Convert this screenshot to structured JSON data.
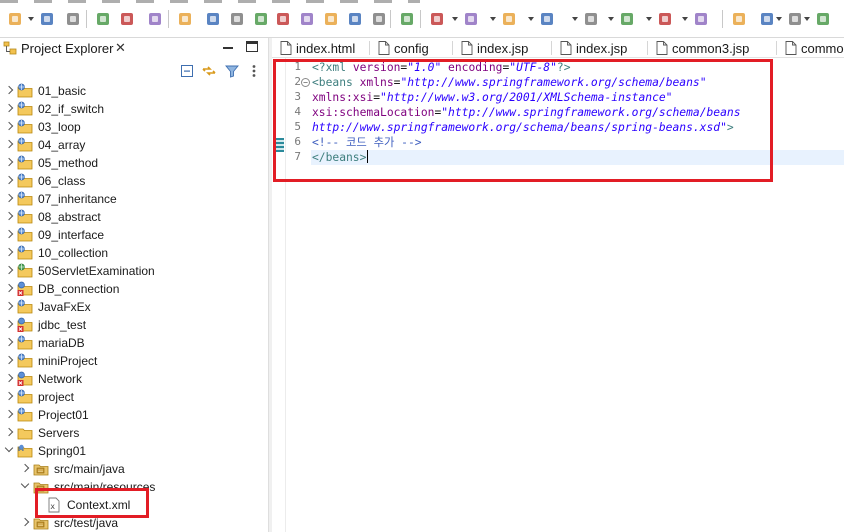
{
  "explorer": {
    "tab_title": "Project Explorer",
    "close_glyph": "✕",
    "view_menu_icon": "view-menu-icon",
    "tree": [
      {
        "label": "01_basic",
        "icon": "web-project-icon",
        "expanded": false
      },
      {
        "label": "02_if_switch",
        "icon": "web-project-icon",
        "expanded": false
      },
      {
        "label": "03_loop",
        "icon": "web-project-icon",
        "expanded": false
      },
      {
        "label": "04_array",
        "icon": "web-project-icon",
        "expanded": false
      },
      {
        "label": "05_method",
        "icon": "web-project-icon",
        "expanded": false
      },
      {
        "label": "06_class",
        "icon": "web-project-icon",
        "expanded": false
      },
      {
        "label": "07_inheritance",
        "icon": "web-project-icon",
        "expanded": false
      },
      {
        "label": "08_abstract",
        "icon": "web-project-icon",
        "expanded": false
      },
      {
        "label": "09_interface",
        "icon": "web-project-icon",
        "expanded": false
      },
      {
        "label": "10_collection",
        "icon": "web-project-icon",
        "expanded": false
      },
      {
        "label": "50ServletExamination",
        "icon": "servlet-project-icon",
        "expanded": false
      },
      {
        "label": "DB_connection",
        "icon": "error-project-icon",
        "expanded": false
      },
      {
        "label": "JavaFxEx",
        "icon": "web-project-icon",
        "expanded": false
      },
      {
        "label": "jdbc_test",
        "icon": "error-project-icon",
        "expanded": false
      },
      {
        "label": "mariaDB",
        "icon": "web-project-icon",
        "expanded": false
      },
      {
        "label": "miniProject",
        "icon": "web-project-icon",
        "expanded": false
      },
      {
        "label": "Network",
        "icon": "error-project-icon",
        "expanded": false
      },
      {
        "label": "project",
        "icon": "web-project-icon",
        "expanded": false
      },
      {
        "label": "Project01",
        "icon": "web-project-icon",
        "expanded": false
      },
      {
        "label": "Servers",
        "icon": "folder-icon",
        "expanded": false
      },
      {
        "label": "Spring01",
        "icon": "maven-project-icon",
        "expanded": true
      },
      {
        "label": "src/main/java",
        "icon": "source-folder-icon",
        "expanded": false
      },
      {
        "label": "src/main/resources",
        "icon": "source-folder-icon",
        "expanded": true
      },
      {
        "label": "Context.xml",
        "icon": "xml-file-icon",
        "expanded": null
      },
      {
        "label": "src/test/java",
        "icon": "source-folder-icon",
        "expanded": false
      }
    ]
  },
  "editor": {
    "tabs": [
      {
        "label": "index.html",
        "icon": "file-icon"
      },
      {
        "label": "config",
        "icon": "file-icon"
      },
      {
        "label": "index.jsp",
        "icon": "file-icon"
      },
      {
        "label": "index.jsp",
        "icon": "file-icon"
      },
      {
        "label": "common3.jsp",
        "icon": "file-icon"
      },
      {
        "label": "commo",
        "icon": "file-icon"
      }
    ],
    "lines": [
      {
        "num": "1",
        "parts": [
          {
            "t": "pi",
            "s": "<?xml "
          },
          {
            "t": "attr",
            "s": "version"
          },
          {
            "t": "eq",
            "s": "="
          },
          {
            "t": "val",
            "s": "\"1.0\""
          },
          {
            "t": "attr",
            "s": " encoding"
          },
          {
            "t": "eq",
            "s": "="
          },
          {
            "t": "val",
            "s": "\"UTF-8\""
          },
          {
            "t": "pi",
            "s": "?>"
          }
        ]
      },
      {
        "num": "2",
        "parts": [
          {
            "t": "tag",
            "s": "<beans "
          },
          {
            "t": "attr",
            "s": "xmlns"
          },
          {
            "t": "eq",
            "s": "="
          },
          {
            "t": "val",
            "s": "\"http://www.springframework.org/schema/beans\""
          }
        ]
      },
      {
        "num": "3",
        "parts": [
          {
            "t": "attr",
            "s": "xmlns:xsi"
          },
          {
            "t": "eq",
            "s": "="
          },
          {
            "t": "val",
            "s": "\"http://www.w3.org/2001/XMLSchema-instance\""
          }
        ]
      },
      {
        "num": "4",
        "parts": [
          {
            "t": "attr",
            "s": "xsi:schemaLocation"
          },
          {
            "t": "eq",
            "s": "="
          },
          {
            "t": "val",
            "s": "\"http://www.springframework.org/schema/beans"
          }
        ]
      },
      {
        "num": "5",
        "parts": [
          {
            "t": "val",
            "s": "http://www.springframework.org/schema/beans/spring-beans.xsd\""
          },
          {
            "t": "tag",
            "s": ">"
          }
        ]
      },
      {
        "num": "6",
        "parts": [
          {
            "t": "com",
            "s": "<!-- 코드 추가 -->"
          }
        ]
      },
      {
        "num": "7",
        "parts": [
          {
            "t": "tag",
            "s": "</beans>"
          }
        ]
      }
    ],
    "fold_glyph": "−",
    "current_line": 7
  },
  "colors": {
    "highlight_box": "#e21d25",
    "tag": "#3f7f7f",
    "attribute": "#7f007f",
    "string": "#2a00ff",
    "comment": "#3f5fbf",
    "current_line": "#e8f2fe"
  },
  "toolbar": {
    "icons": [
      "new-icon",
      "save-icon",
      "save-all-icon",
      "print-icon",
      "properties-icon",
      "terminal-icon",
      "skip-breakpoints-icon",
      "resume-icon",
      "suspend-icon",
      "terminate-icon",
      "disconnect-icon",
      "step-into-icon",
      "step-over-icon",
      "step-return-icon",
      "drop-to-frame-icon",
      "use-step-filters-icon",
      "debug-icon",
      "run-icon",
      "coverage-icon",
      "external-tools-icon",
      "new-java-project-icon",
      "new-package-icon",
      "new-class-icon",
      "open-type-icon",
      "search-icon",
      "globe-icon",
      "annotation-icon",
      "next-annotation-icon",
      "pin-icon"
    ]
  }
}
